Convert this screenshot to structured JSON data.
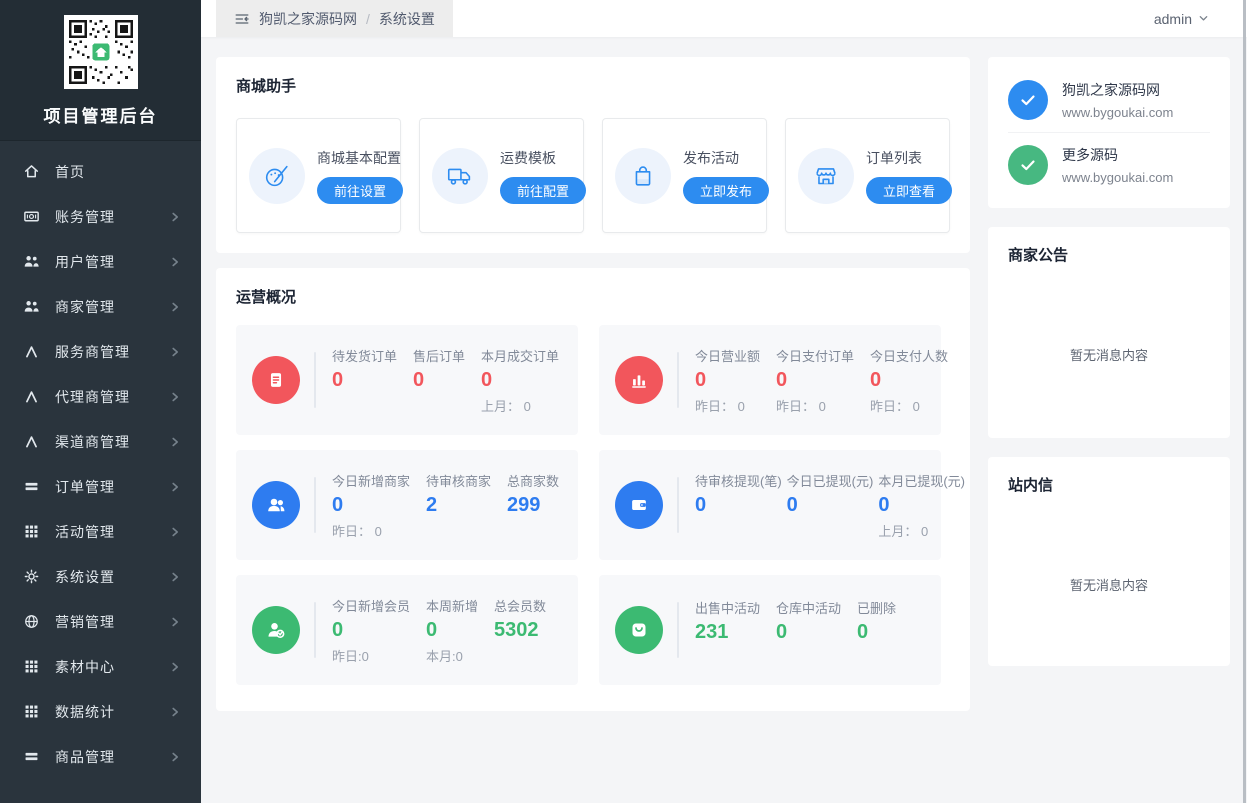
{
  "colors": {
    "accent-blue": "#2d8cf0",
    "stat-red": "#f2565c",
    "stat-blue": "#2e7cf0",
    "stat-green": "#3cba72",
    "check-green": "#47b881"
  },
  "sidebar": {
    "title": "项目管理后台",
    "items": [
      {
        "label": "首页",
        "icon": "home-icon",
        "has_children": false
      },
      {
        "label": "账务管理",
        "icon": "finance-icon",
        "has_children": true
      },
      {
        "label": "用户管理",
        "icon": "users-icon",
        "has_children": true
      },
      {
        "label": "商家管理",
        "icon": "merchants-icon",
        "has_children": true
      },
      {
        "label": "服务商管理",
        "icon": "provider-icon",
        "has_children": true
      },
      {
        "label": "代理商管理",
        "icon": "agent-icon",
        "has_children": true
      },
      {
        "label": "渠道商管理",
        "icon": "channel-icon",
        "has_children": true
      },
      {
        "label": "订单管理",
        "icon": "orders-icon",
        "has_children": true
      },
      {
        "label": "活动管理",
        "icon": "activity-grid-icon",
        "has_children": true
      },
      {
        "label": "系统设置",
        "icon": "gear-icon",
        "has_children": true
      },
      {
        "label": "营销管理",
        "icon": "globe-icon",
        "has_children": true
      },
      {
        "label": "素材中心",
        "icon": "assets-grid-icon",
        "has_children": true
      },
      {
        "label": "数据统计",
        "icon": "stats-grid-icon",
        "has_children": true
      },
      {
        "label": "商品管理",
        "icon": "goods-icon",
        "has_children": true
      }
    ]
  },
  "topbar": {
    "breadcrumb": {
      "first": "狗凯之家源码网",
      "separator": "/",
      "current": "系统设置"
    },
    "user": "admin"
  },
  "helper": {
    "title": "商城助手",
    "cards": [
      {
        "title": "商城基本配置",
        "button": "前往设置",
        "icon": "palette-icon"
      },
      {
        "title": "运费模板",
        "button": "前往配置",
        "icon": "truck-icon"
      },
      {
        "title": "发布活动",
        "button": "立即发布",
        "icon": "shopping-bag-icon"
      },
      {
        "title": "订单列表",
        "button": "立即查看",
        "icon": "storefront-icon"
      }
    ]
  },
  "overview": {
    "title": "运营概况",
    "blocks": [
      {
        "icon": "document-icon",
        "color": "red",
        "stats": [
          {
            "label": "待发货订单",
            "value": "0",
            "sub": ""
          },
          {
            "label": "售后订单",
            "value": "0",
            "sub": ""
          },
          {
            "label": "本月成交订单",
            "value": "0",
            "sub": "上月： 0"
          }
        ]
      },
      {
        "icon": "bar-chart-icon",
        "color": "red",
        "stats": [
          {
            "label": "今日营业额",
            "value": "0",
            "sub": "昨日： 0"
          },
          {
            "label": "今日支付订单",
            "value": "0",
            "sub": "昨日： 0"
          },
          {
            "label": "今日支付人数",
            "value": "0",
            "sub": "昨日： 0"
          }
        ]
      },
      {
        "icon": "users-icon",
        "color": "blue",
        "stats": [
          {
            "label": "今日新增商家",
            "value": "0",
            "sub": "昨日： 0"
          },
          {
            "label": "待审核商家",
            "value": "2",
            "sub": ""
          },
          {
            "label": "总商家数",
            "value": "299",
            "sub": ""
          }
        ]
      },
      {
        "icon": "wallet-icon",
        "color": "blue",
        "stats": [
          {
            "label": "待审核提现(笔)",
            "value": "0",
            "sub": ""
          },
          {
            "label": "今日已提现(元)",
            "value": "0",
            "sub": ""
          },
          {
            "label": "本月已提现(元)",
            "value": "0",
            "sub": "上月： 0"
          }
        ]
      },
      {
        "icon": "member-icon",
        "color": "green",
        "stats": [
          {
            "label": "今日新增会员",
            "value": "0",
            "sub": "昨日:0"
          },
          {
            "label": "本周新增",
            "value": "0",
            "sub": "本月:0"
          },
          {
            "label": "总会员数",
            "value": "5302",
            "sub": ""
          }
        ]
      },
      {
        "icon": "bag-icon",
        "color": "green",
        "stats": [
          {
            "label": "出售中活动",
            "value": "231",
            "sub": ""
          },
          {
            "label": "仓库中活动",
            "value": "0",
            "sub": ""
          },
          {
            "label": "已删除",
            "value": "0",
            "sub": ""
          }
        ]
      }
    ]
  },
  "rightbar": {
    "links": [
      {
        "title": "狗凯之家源码网",
        "url": "www.bygoukai.com",
        "icon": "check-circle-blue-icon"
      },
      {
        "title": "更多源码",
        "url": "www.bygoukai.com",
        "icon": "check-circle-green-icon"
      }
    ],
    "notice": {
      "title": "商家公告",
      "empty": "暂无消息内容"
    },
    "messages": {
      "title": "站内信",
      "empty": "暂无消息内容"
    }
  }
}
